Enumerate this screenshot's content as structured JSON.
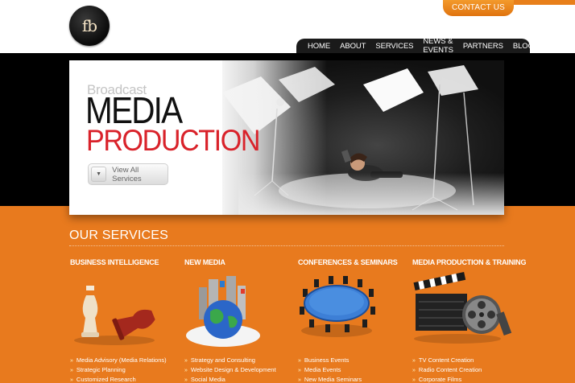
{
  "brand": {
    "logo_text": "fb"
  },
  "header": {
    "contact_label": "CONTACT US"
  },
  "nav": {
    "items": [
      "HOME",
      "ABOUT",
      "SERVICES",
      "NEWS & EVENTS",
      "PARTNERS",
      "BLOGS"
    ],
    "active": "HOME"
  },
  "hero": {
    "kicker": "Broadcast",
    "title_line1": "MEDIA",
    "title_line2": "PRODUCTION",
    "button_label": "View All Services"
  },
  "services": {
    "title": "OUR SERVICES",
    "columns": [
      {
        "heading": "BUSINESS INTELLIGENCE",
        "items": [
          "Media Advisory (Media Relations)",
          "Strategic Planning",
          "Customized Research"
        ]
      },
      {
        "heading": "NEW MEDIA",
        "items": [
          "Strategy and Consulting",
          "Website Design & Development",
          "Social Media"
        ]
      },
      {
        "heading": "CONFERENCES & SEMINARS",
        "items": [
          "Business Events",
          "Media Events",
          "New Media Seminars"
        ]
      },
      {
        "heading": "MEDIA PRODUCTION & TRAINING",
        "items": [
          "TV Content Creation",
          "Radio Content Creation",
          "Corporate Films"
        ]
      }
    ]
  },
  "colors": {
    "orange": "#e87a1e",
    "red": "#d9222a",
    "nav_bg": "#1a1a1a"
  }
}
